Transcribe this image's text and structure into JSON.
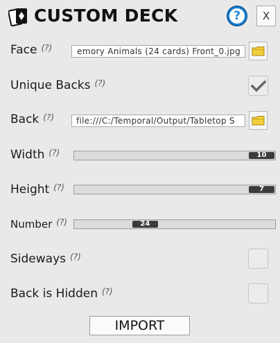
{
  "dialog": {
    "title": "CUSTOM DECK",
    "help_label": "?",
    "close_label": "X"
  },
  "hint_text": "(?)",
  "face": {
    "label": "Face",
    "value": "emory Animals (24 cards) Front_0.jpg"
  },
  "unique_backs": {
    "label": "Unique Backs",
    "checked": true
  },
  "back": {
    "label": "Back",
    "value": "file:///C:/Temporal/Output/Tabletop S"
  },
  "width": {
    "label": "Width",
    "value": "10",
    "position": 1.0
  },
  "height": {
    "label": "Height",
    "value": "7",
    "position": 1.0
  },
  "number": {
    "label": "Number",
    "value": "24",
    "position": 0.33
  },
  "sideways": {
    "label": "Sideways",
    "checked": false
  },
  "back_is_hidden": {
    "label": "Back is Hidden",
    "checked": false
  },
  "import_label": "IMPORT",
  "colors": {
    "background": "#e9e9e9",
    "help_blue": "#1f84d4",
    "folder_yellow": "#f2cf3a",
    "slider_thumb": "#3c3c3c"
  }
}
